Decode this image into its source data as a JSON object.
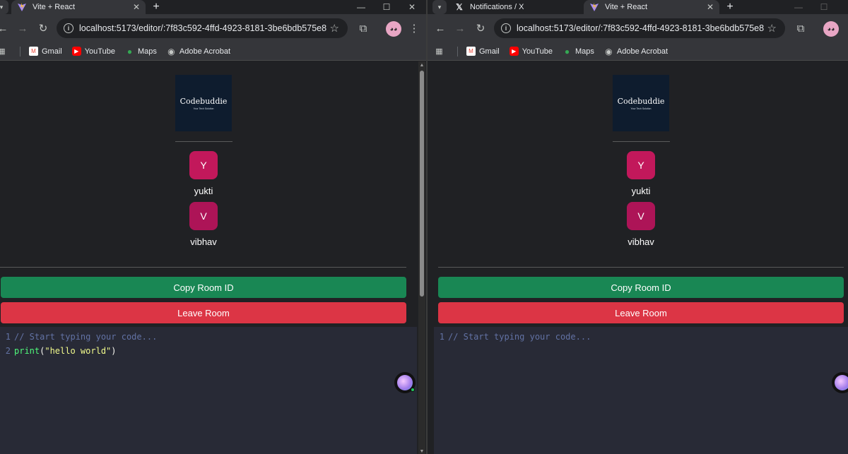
{
  "left_window": {
    "tabs": [
      {
        "title": "Vite + React",
        "active": true
      }
    ],
    "url": "localhost:5173/editor/:7f83c592-4ffd-4923-8181-3be6bdb575e8",
    "bookmarks": [
      "Gmail",
      "YouTube",
      "Maps",
      "Adobe Acrobat"
    ],
    "app": {
      "logo_text": "Codebuddie",
      "logo_tagline": "Your Tech Solution",
      "users": [
        {
          "initial": "Y",
          "name": "yukti",
          "color": "#c2185b"
        },
        {
          "initial": "V",
          "name": "vibhav",
          "color": "#ad1457"
        }
      ],
      "copy_button": "Copy Room ID",
      "leave_button": "Leave Room",
      "code": [
        {
          "num": "1",
          "text": "// Start typing your code..."
        },
        {
          "num": "2",
          "fn": "print",
          "open": "(",
          "str": "\"hello world\"",
          "close": ")"
        }
      ]
    }
  },
  "right_window": {
    "tabs": [
      {
        "title": "Notifications / X",
        "active": false
      },
      {
        "title": "Vite + React",
        "active": true
      }
    ],
    "url": "localhost:5173/editor/:7f83c592-4ffd-4923-8181-3be6bdb575e8",
    "bookmarks": [
      "Gmail",
      "YouTube",
      "Maps",
      "Adobe Acrobat"
    ],
    "app": {
      "logo_text": "Codebuddie",
      "logo_tagline": "Your Tech Solution",
      "users": [
        {
          "initial": "Y",
          "name": "yukti",
          "color": "#c2185b"
        },
        {
          "initial": "V",
          "name": "vibhav",
          "color": "#ad1457"
        }
      ],
      "copy_button": "Copy Room ID",
      "leave_button": "Leave Room",
      "code": [
        {
          "num": "1",
          "text": "// Start typing your code..."
        }
      ]
    }
  },
  "colors": {
    "copy_green": "#198754",
    "leave_red": "#dc3545",
    "editor_bg": "#282a36",
    "page_bg": "#202124"
  },
  "icons": [
    "vite-icon",
    "x-icon",
    "close-icon",
    "back-arrow-icon",
    "forward-arrow-icon",
    "reload-icon",
    "info-icon",
    "star-icon",
    "extensions-icon",
    "more-icon",
    "apps-grid-icon",
    "gmail-icon",
    "youtube-icon",
    "maps-icon",
    "acrobat-icon",
    "minimize-icon",
    "maximize-icon"
  ]
}
